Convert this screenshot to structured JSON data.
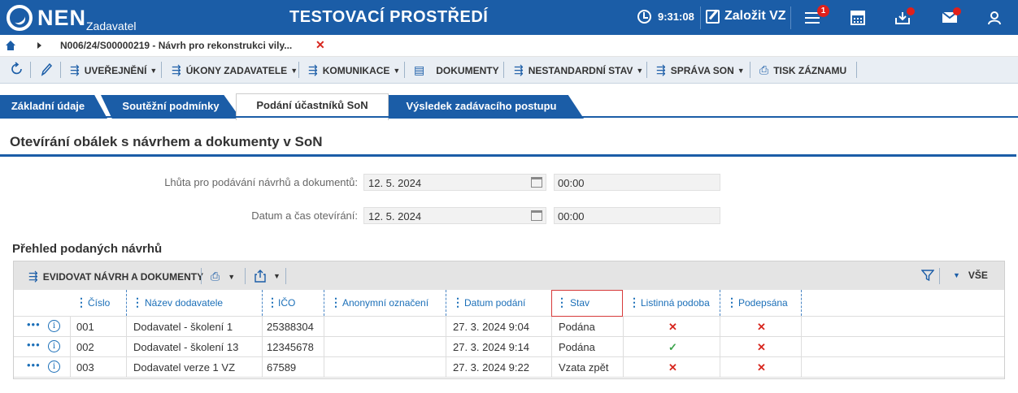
{
  "header": {
    "logo": "NEN",
    "logo_sub": "Zadavatel",
    "env_title": "TESTOVACÍ PROSTŘEDÍ",
    "time": "9:31:08",
    "create_label": "Založit VZ",
    "menu_badge": "1",
    "colors": {
      "brand": "#1b5da7",
      "alert": "#e0201b"
    }
  },
  "breadcrumb": {
    "text": "N006/24/S00000219 - Návrh pro rekonstrukci vily...",
    "close": "✕"
  },
  "toolbar": {
    "items": [
      {
        "label": "UVEŘEJNĚNÍ"
      },
      {
        "label": "ÚKONY ZADAVATELE"
      },
      {
        "label": "KOMUNIKACE"
      },
      {
        "label": "DOKUMENTY"
      },
      {
        "label": "NESTANDARDNÍ STAV"
      },
      {
        "label": "SPRÁVA SON"
      },
      {
        "label": "TISK ZÁZNAMU"
      }
    ]
  },
  "tabs": [
    {
      "label": "Základní údaje"
    },
    {
      "label": "Soutěžní podmínky"
    },
    {
      "label": "Podání účastníků SoN",
      "active": true
    },
    {
      "label": "Výsledek zadávacího postupu"
    }
  ],
  "section": {
    "title": "Otevírání obálek s návrhem a dokumenty v SoN"
  },
  "form": {
    "deadline_label": "Lhůta pro podávání návrhů a dokumentů:",
    "deadline_date": "12. 5. 2024",
    "deadline_time": "00:00",
    "opening_label": "Datum a čas otevírání:",
    "opening_date": "12. 5. 2024",
    "opening_time": "00:00"
  },
  "list": {
    "title": "Přehled podaných návrhů",
    "toolbar_action": "EVIDOVAT NÁVRH A DOKUMENTY",
    "filter_all": "VŠE",
    "columns": [
      "Číslo",
      "Název dodavatele",
      "IČO",
      "Anonymní označení",
      "Datum podání",
      "Stav",
      "Listinná podoba",
      "Podepsána"
    ],
    "rows": [
      {
        "cislo": "001",
        "nazev": "Dodavatel - školení 1",
        "ico": "25388304",
        "anon": "",
        "datum": "27. 3. 2024 9:04",
        "stav": "Podána",
        "listinna": "✕",
        "podepsana": "✕"
      },
      {
        "cislo": "002",
        "nazev": "Dodavatel - školení 13",
        "ico": "12345678",
        "anon": "",
        "datum": "27. 3. 2024 9:14",
        "stav": "Podána",
        "listinna": "✓",
        "podepsana": "✕"
      },
      {
        "cislo": "003",
        "nazev": "Dodavatel verze 1 VZ",
        "ico": "67589",
        "anon": "",
        "datum": "27. 3. 2024 9:22",
        "stav": "Vzata zpět",
        "listinna": "✕",
        "podepsana": "✕"
      }
    ]
  }
}
